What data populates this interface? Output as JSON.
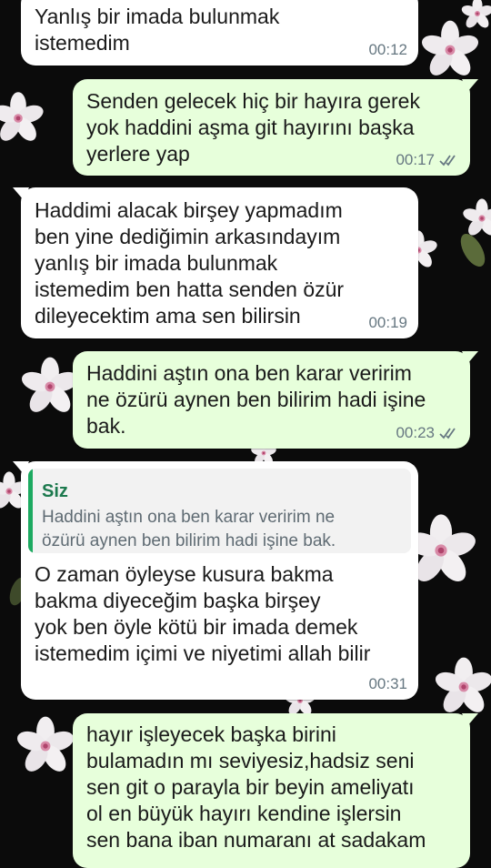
{
  "chat": {
    "messages": [
      {
        "direction": "in",
        "text": "Yanlış bir imada bulunmak\nistemedim",
        "time": "00:12"
      },
      {
        "direction": "out",
        "text": "Senden gelecek hiç bir hayıra gerek\nyok haddini aşma git hayırını başka\nyerlere yap",
        "time": "00:17",
        "status": "read"
      },
      {
        "direction": "in",
        "text": "Haddimi alacak birşey yapmadım\nben yine dediğimin arkasındayım\nyanlış bir imada bulunmak\nistemedim ben hatta senden özür\ndileyecektim ama sen bilirsin",
        "time": "00:19"
      },
      {
        "direction": "out",
        "text": "Haddini aştın ona ben karar veririm\nne özürü aynen ben bilirim hadi işine\nbak.",
        "time": "00:23",
        "status": "read"
      },
      {
        "direction": "in",
        "text": "O zaman öyleyse kusura bakma\nbakma diyeceğim başka birşey\nyok ben öyle kötü bir imada demek\nistemedim içimi ve niyetimi allah bilir",
        "time": "00:31",
        "quote": {
          "author": "Siz",
          "text": "Haddini aştın ona ben karar veririm ne\nözürü aynen ben bilirim hadi işine bak."
        }
      },
      {
        "direction": "out",
        "text": "hayır işleyecek başka birini\nbulamadın mı seviyesiz,hadsiz seni\nsen git o parayla bir beyin ameliyatı\nol en büyük hayırı kendine işlersin\nsen bana iban numaranı at sadakam"
      }
    ]
  },
  "colors": {
    "wallpaper": "#0b0b0b",
    "incoming_bubble": "#ffffff",
    "outgoing_bubble": "#e7ffdb",
    "time_text": "#667781",
    "read_ticks": "#667781",
    "quote_accent": "#1daa61",
    "quote_author": "#1d7a4e"
  },
  "icons": {
    "read_status": "double-check-icon",
    "wallpaper_flower": "cherry-blossom-icon"
  }
}
